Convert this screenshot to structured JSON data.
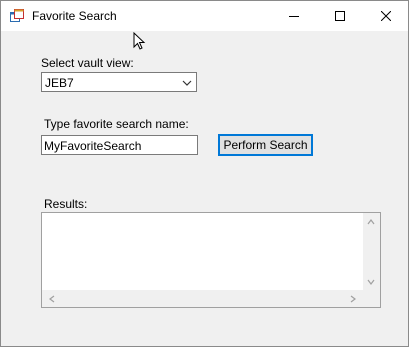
{
  "window": {
    "title": "Favorite Search",
    "icons": {
      "app": "app-window-icon",
      "minimize": "minimize-icon",
      "maximize": "maximize-icon",
      "close": "close-icon"
    }
  },
  "form": {
    "vault_label": "Select vault view:",
    "vault_value": "JEB7",
    "search_name_label": "Type favorite search name:",
    "search_name_value": "MyFavoriteSearch",
    "perform_button": "Perform Search",
    "results_label": "Results:"
  },
  "colors": {
    "accent": "#0078d7",
    "window_bg": "#f0f0f0"
  }
}
